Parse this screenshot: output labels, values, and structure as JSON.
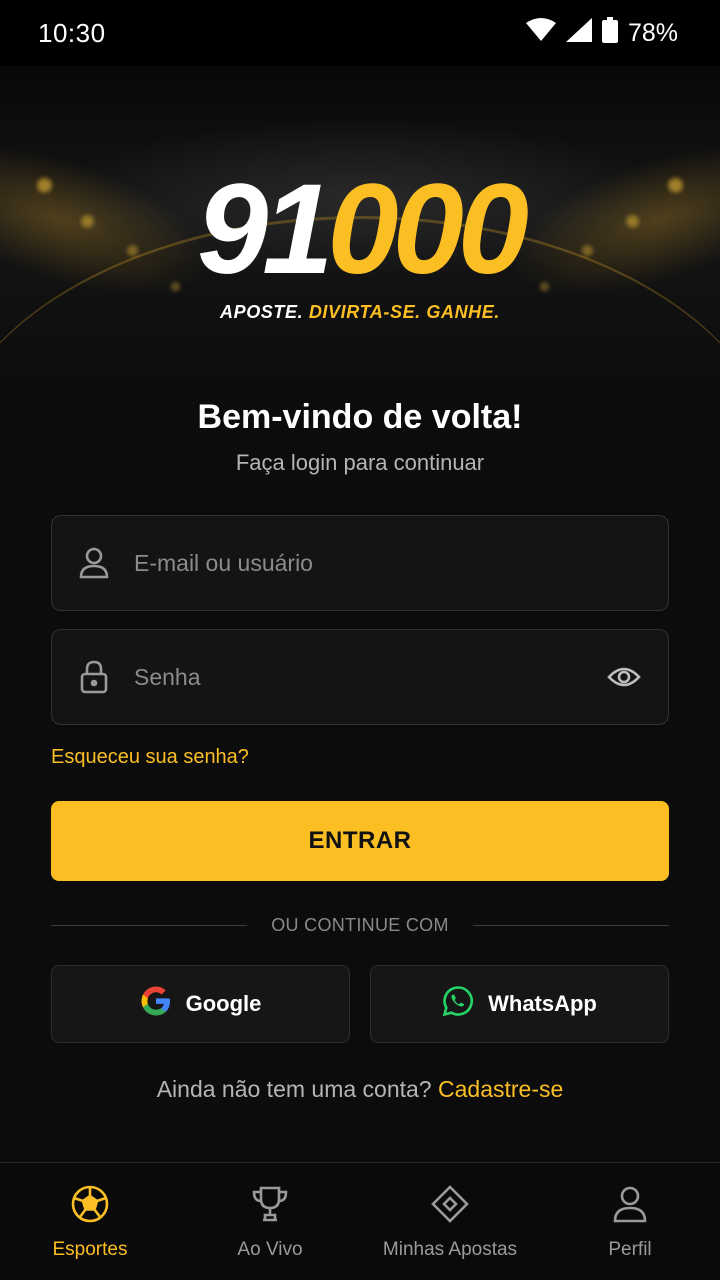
{
  "status_bar": {
    "time": "10:30",
    "battery": "78%"
  },
  "brand": {
    "logo_white": "91",
    "logo_yellow": "000",
    "tagline_white": "APOSTE.",
    "tagline_yellow": "DIVIRTA-SE. GANHE.",
    "accent_color": "#fbbf24"
  },
  "login": {
    "title": "Bem-vindo de volta!",
    "subtitle": "Faça login para continuar",
    "email_placeholder": "E-mail ou usuário",
    "password_placeholder": "Senha",
    "forgot_password": "Esqueceu sua senha?",
    "submit_label": "ENTRAR",
    "divider_text": "OU CONTINUE COM",
    "google_label": "Google",
    "whatsapp_label": "WhatsApp",
    "signup_prompt": "Ainda não tem uma conta?",
    "signup_link": "Cadastre-se"
  },
  "bottom_nav": {
    "items": [
      {
        "label": "Esportes",
        "icon": "soccer-ball-icon",
        "active": true
      },
      {
        "label": "Ao Vivo",
        "icon": "trophy-icon",
        "active": false
      },
      {
        "label": "Minhas Apostas",
        "icon": "ticket-diamond-icon",
        "active": false
      },
      {
        "label": "Perfil",
        "icon": "user-icon",
        "active": false
      }
    ]
  }
}
